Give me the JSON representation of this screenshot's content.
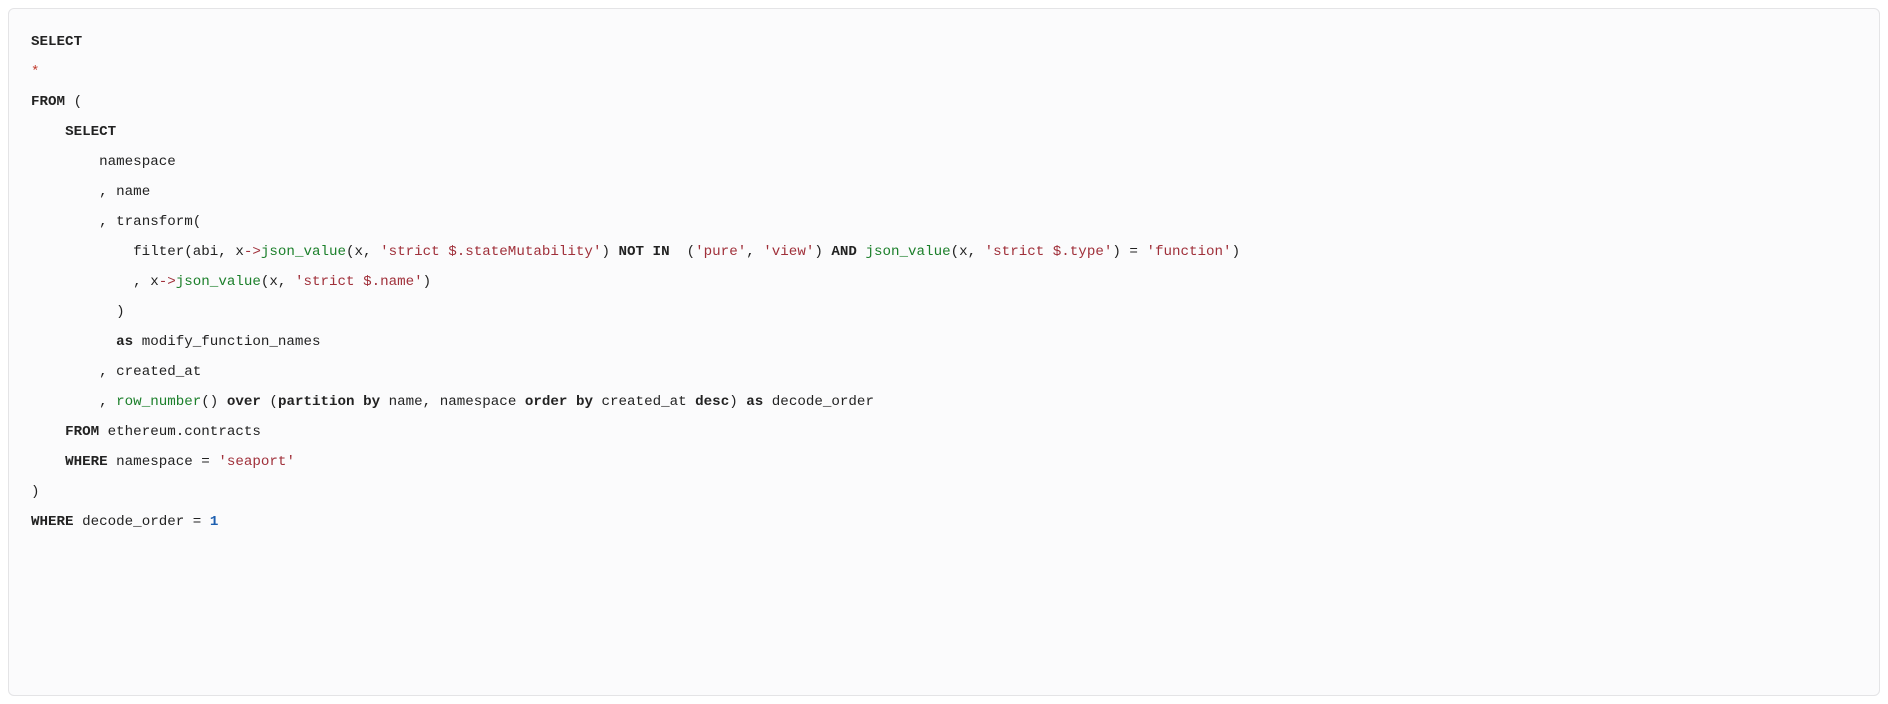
{
  "sql": {
    "kw_select": "SELECT",
    "star": "*",
    "kw_from": "FROM",
    "paren_open": "(",
    "paren_close": ")",
    "col_namespace": "namespace",
    "comma": ",",
    "col_name": "name",
    "fn_transform": "transform(",
    "fn_filter": "filter(abi, x",
    "arrow": "->",
    "fn_json_value": "json_value",
    "jv_args_state": "(x, ",
    "str_state": "'strict $.stateMutability'",
    "jv_close_state": ") ",
    "kw_not": "NOT",
    "kw_in": " IN",
    "in_open": "  (",
    "str_pure": "'pure'",
    "sep": ", ",
    "str_view": "'view'",
    "in_close": ") ",
    "kw_and": "AND",
    "jv_args_type": "(x, ",
    "str_type": "'strict $.type'",
    "jv_close_type": ") ",
    "eq": "=",
    "str_function": "'function'",
    "line3_tail": ")",
    "line4_lead": ", x",
    "jv_args_name": "(x, ",
    "str_name": "'strict $.name'",
    "jv_close_name": ")",
    "kw_as": "as",
    "alias_modify": "modify_function_names",
    "col_created_at": "created_at",
    "fn_row_number": "row_number",
    "rn_call": "() ",
    "kw_over": "over",
    "over_open": " (",
    "kw_partition": "partition",
    "kw_by": " by",
    "part_cols": " name, namespace ",
    "kw_order": "order",
    "kw_by2": " by",
    "ord_col": " created_at ",
    "kw_desc": "desc",
    "over_close": ") ",
    "alias_decode": "decode_order",
    "inner_from_table": " ethereum.contracts",
    "kw_where": "WHERE",
    "where_ns": " namespace ",
    "str_seaport": "'seaport'",
    "where_decode": " decode_order ",
    "num_one": "1",
    "space": " "
  }
}
